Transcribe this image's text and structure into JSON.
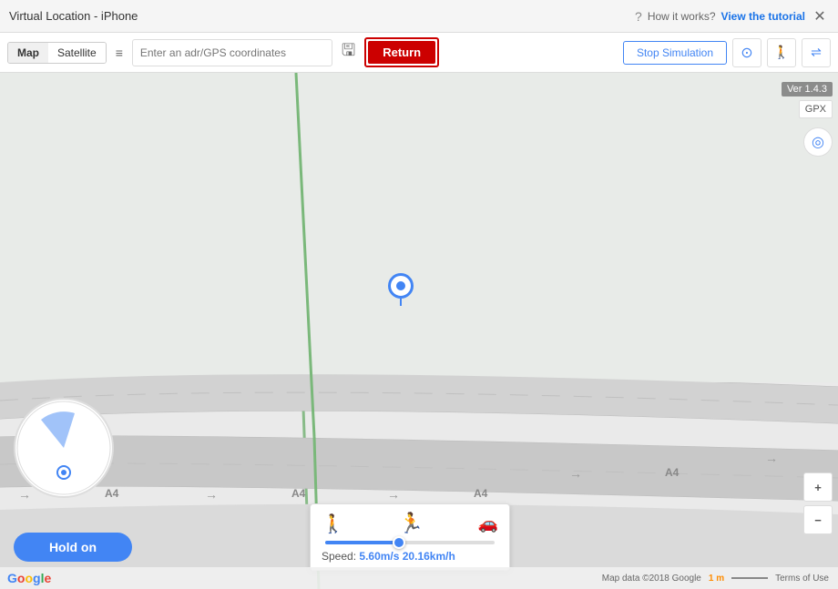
{
  "titlebar": {
    "title": "Virtual Location - iPhone",
    "help_text": "How it works?",
    "tutorial_text": "View the tutorial",
    "close_label": "✕"
  },
  "toolbar": {
    "map_label": "Map",
    "satellite_label": "Satellite",
    "address_placeholder": "Enter an adr/GPS coordinates",
    "return_label": "Return",
    "stop_simulation_label": "Stop Simulation"
  },
  "map": {
    "version": "Ver 1.4.3",
    "road_labels": [
      "A4",
      "A4",
      "A4",
      "A4"
    ],
    "gpx_label": "GPX",
    "zoom_in": "+",
    "zoom_out": "−"
  },
  "speed_widget": {
    "label": "Speed:",
    "value": "5.60m/s 20.16km/h"
  },
  "hold_on_btn": "Hold on",
  "bottom_bar": {
    "map_data": "Map data ©2018 Google",
    "scale_label": "1 m",
    "terms": "Terms of Use"
  },
  "icons": {
    "list_icon": "≡",
    "save_icon": "💾",
    "target_icon": "◎",
    "walk_icon": "🚶",
    "run_icon": "🏃",
    "car_icon": "🚗",
    "question_icon": "?",
    "share_icon": "⇌"
  }
}
